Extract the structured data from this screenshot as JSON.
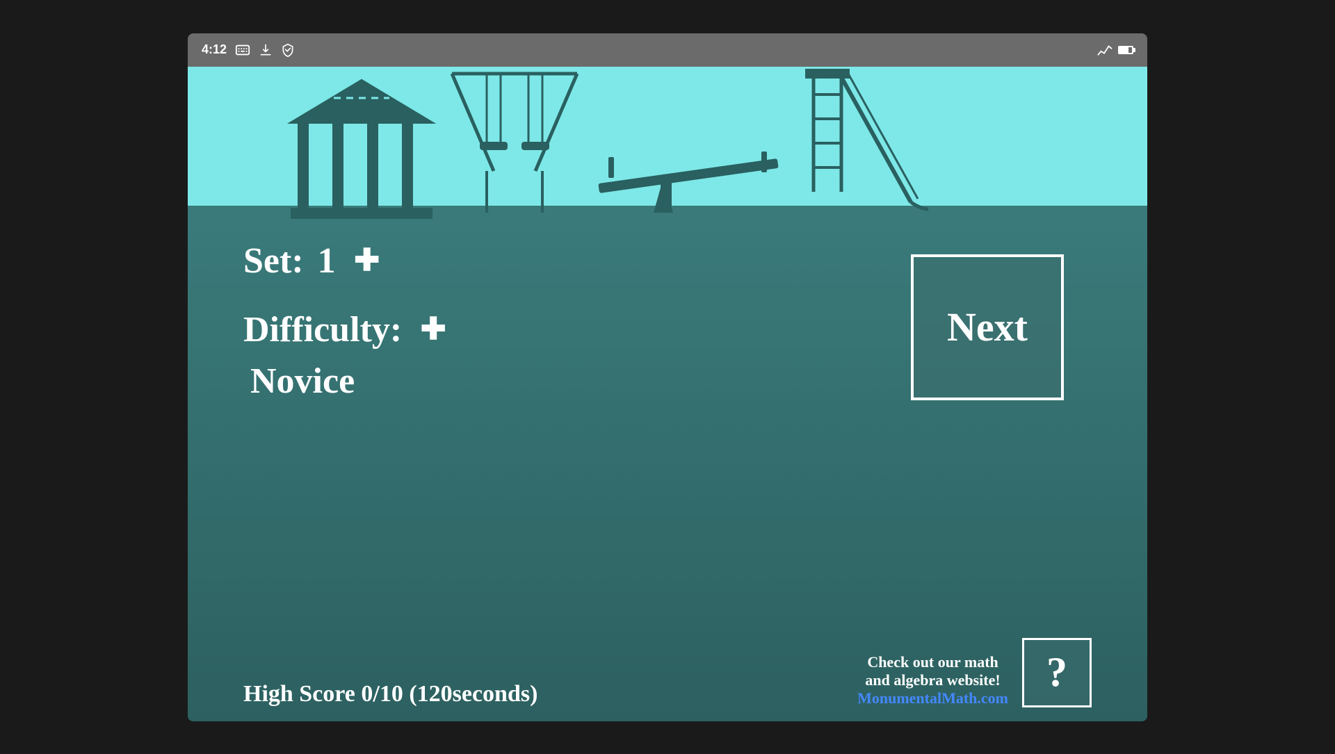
{
  "statusBar": {
    "time": "4:12",
    "icons": [
      "A",
      "download-icon",
      "shield-icon"
    ]
  },
  "playground": {
    "skyColor": "#7ee8e8",
    "groundColor": "#2d6b6b"
  },
  "game": {
    "setLabel": "Set:",
    "setValue": "1",
    "difficultyLabel": "Difficulty:",
    "difficultyValue": "Novice",
    "nextButtonLabel": "Next",
    "highScore": "High Score 0/10 (120seconds)",
    "plusIcon": "✚",
    "websitePrompt": "Check out our math",
    "websitePrompt2": "and algebra website!",
    "websiteUrl": "MonumentalMath.com",
    "helpButtonLabel": "?"
  }
}
